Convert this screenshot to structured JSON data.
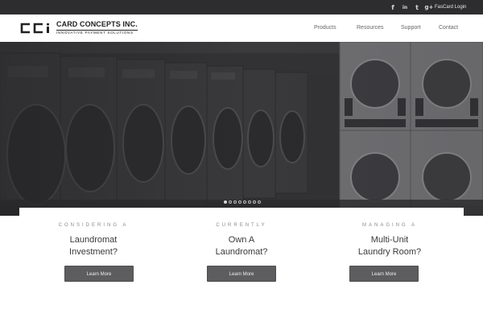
{
  "topbar": {
    "social": [
      {
        "name": "facebook-icon",
        "glyph": "f"
      },
      {
        "name": "linkedin-icon",
        "glyph": "in"
      },
      {
        "name": "twitter-icon",
        "glyph": "t"
      },
      {
        "name": "google-plus-icon",
        "glyph": "g+"
      }
    ],
    "login_label": "FasCard Login"
  },
  "header": {
    "brand_name": "CARD CONCEPTS INC.",
    "brand_tagline": "INNOVATIVE PAYMENT SOLUTIONS",
    "logo_mark": "CCi",
    "nav": [
      "Products",
      "Resources",
      "Support",
      "Contact"
    ]
  },
  "hero": {
    "image": "laundromat-washing-machines",
    "slides_total": 8,
    "active_slide": 1
  },
  "cards": [
    {
      "eyebrow": "CONSIDERING A",
      "line1": "Laundromat",
      "line2": "Investment?",
      "button": "Learn More"
    },
    {
      "eyebrow": "CURRENTLY",
      "line1": "Own A",
      "line2": "Laundromat?",
      "button": "Learn More"
    },
    {
      "eyebrow": "MANAGING A",
      "line1": "Multi-Unit",
      "line2": "Laundry Room?",
      "button": "Learn More"
    }
  ],
  "colors": {
    "topbar": "#2d2d30",
    "hero": "#3c3c3f",
    "button": "#5d5d60"
  }
}
